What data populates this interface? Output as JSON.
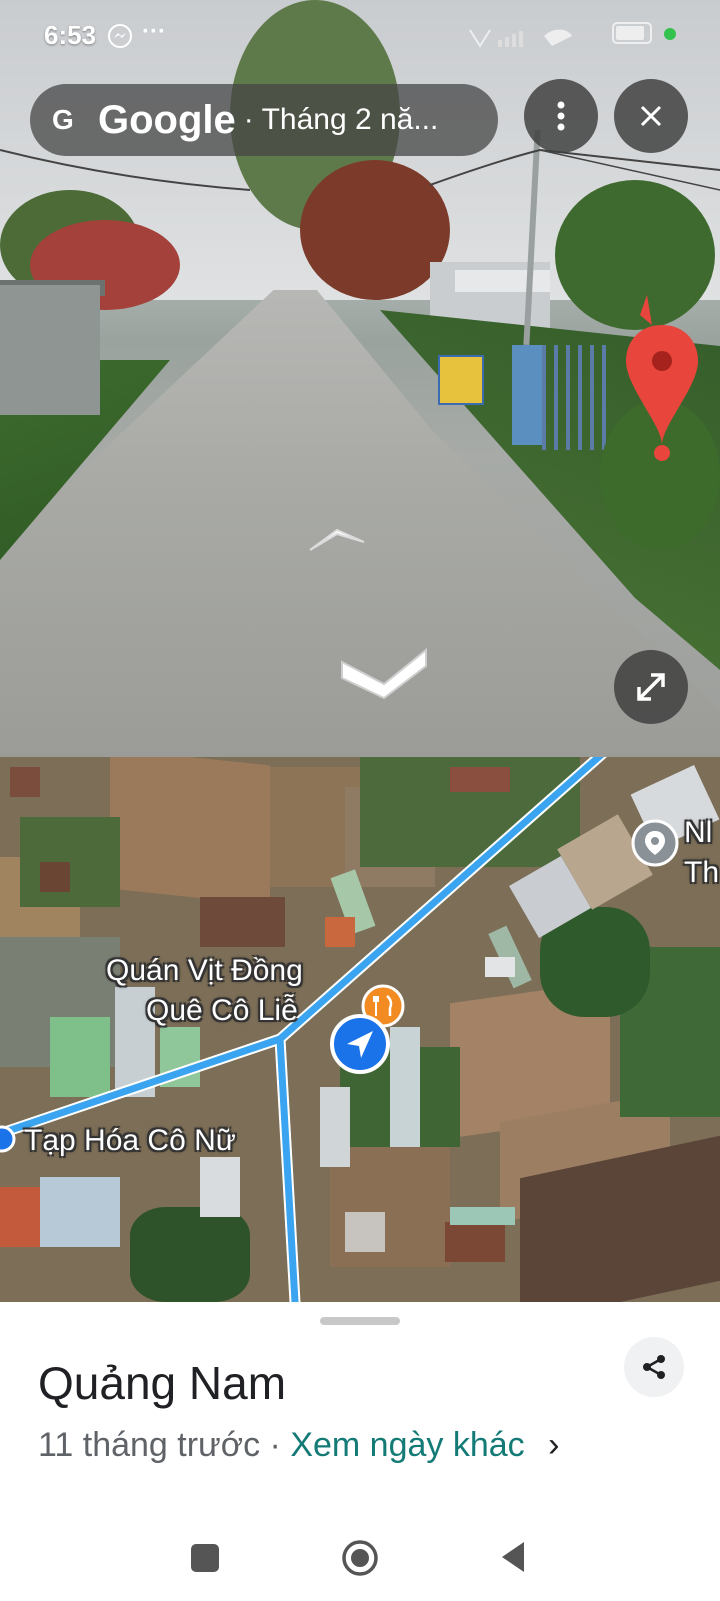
{
  "status_bar": {
    "time": "6:53",
    "messenger_icon": "messenger-icon",
    "more_dots": "···",
    "battery_level": "90"
  },
  "street_view": {
    "provider": "Google",
    "date_label": "· Tháng 2 nă...",
    "more_icon": "more-vertical-icon",
    "close_icon": "close-icon",
    "expand_icon": "expand-icon"
  },
  "map": {
    "labels": {
      "restaurant_line1": "Quán Vịt Đồng",
      "restaurant_line2": "Quê Cô Liễ",
      "store": "Tạp Hóa Cô Nữ",
      "edge_line1": "Nl",
      "edge_line2": "Th"
    },
    "colors": {
      "route": "#3aa4f0",
      "restaurant_pin": "#f28b21",
      "location_arrow": "#1a73e8"
    }
  },
  "sheet": {
    "title": "Quảng Nam",
    "time_ago": "11 tháng trước",
    "separator": " · ",
    "other_dates_link": "Xem ngày khác",
    "chevron": "›"
  },
  "colors": {
    "link": "#137a76",
    "pin": "#e8453c"
  }
}
